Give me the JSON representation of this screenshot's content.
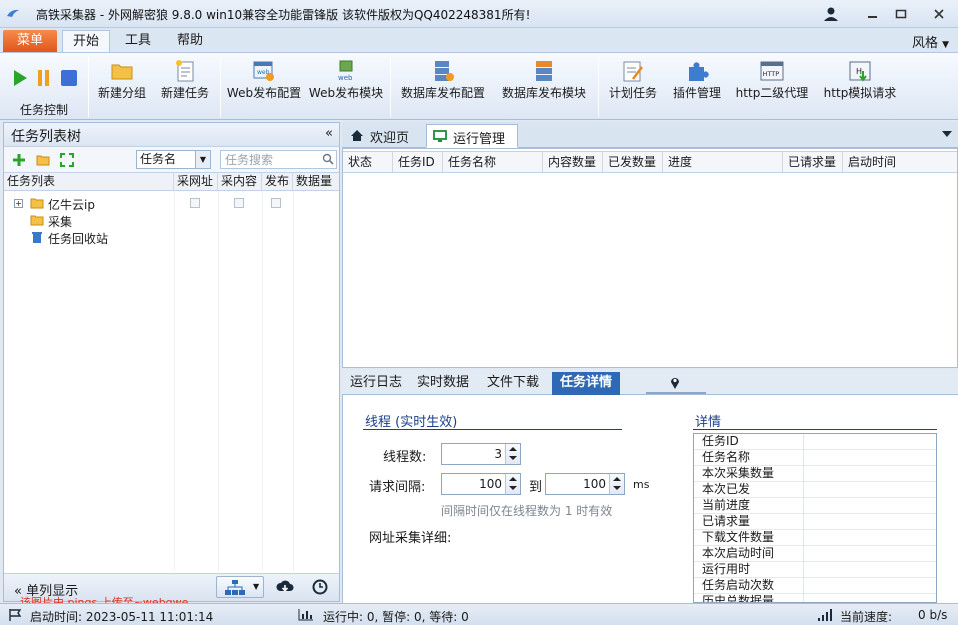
{
  "window": {
    "title": "高铁采集器 - 外网解密狼 9.8.0 win10兼容全功能雷锋版  该软件版权为QQ402248381所有!"
  },
  "ribbon_tabs": {
    "menu": "菜单",
    "start": "开始",
    "tools": "工具",
    "help": "帮助",
    "style": "风格"
  },
  "ribbon": {
    "task_control": "任务控制",
    "buttons": [
      {
        "label": "新建分组",
        "icon": "folder-icon"
      },
      {
        "label": "新建任务",
        "icon": "new-task-icon"
      },
      {
        "label": "Web发布配置",
        "icon": "web-config-icon"
      },
      {
        "label": "Web发布模块",
        "icon": "web-module-icon"
      },
      {
        "label": "数据库发布配置",
        "icon": "db-config-icon"
      },
      {
        "label": "数据库发布模块",
        "icon": "db-module-icon"
      },
      {
        "label": "计划任务",
        "icon": "schedule-icon"
      },
      {
        "label": "插件管理",
        "icon": "plugin-icon"
      },
      {
        "label": "http二级代理",
        "icon": "http-proxy-icon"
      },
      {
        "label": "http模拟请求",
        "icon": "http-request-icon"
      }
    ],
    "icon_text": {
      "web": "web",
      "http": "HTTP",
      "h": "H"
    }
  },
  "left_panel": {
    "title": "任务列表树",
    "collapse_glyph": "«",
    "field_select": "任务名",
    "search_placeholder": "任务搜索",
    "columns": [
      "任务列表",
      "采网址",
      "采内容",
      "发布",
      "数据量"
    ],
    "tree": [
      {
        "label": "亿牛云ip",
        "expander": "+"
      },
      {
        "label": "采集"
      },
      {
        "label": "任务回收站"
      }
    ],
    "single_column": "单列显示",
    "single_column_glyph": "«"
  },
  "watermark": "该图片由 pings 上传至~webqwe",
  "doc_tabs": {
    "welcome": "欢迎页",
    "run_manage": "运行管理"
  },
  "grid": {
    "columns": [
      "状态",
      "任务ID",
      "任务名称",
      "内容数量",
      "已发数量",
      "进度",
      "已请求量",
      "启动时间"
    ]
  },
  "bottom_tabs": [
    "运行日志",
    "实时数据",
    "文件下载",
    "任务详情"
  ],
  "detail_pane": {
    "thread_title": "线程 (实时生效)",
    "thread_count_label": "线程数:",
    "thread_count": "3",
    "interval_label": "请求间隔:",
    "interval_from": "100",
    "to_label": "到",
    "interval_to": "100",
    "unit": "ms",
    "interval_hint": "间隔时间仅在线程数为 1 时有效",
    "url_detail_label": "网址采集详细:",
    "details_title": "详情",
    "details_rows": [
      "任务ID",
      "任务名称",
      "本次采集数量",
      "本次已发",
      "当前进度",
      "已请求量",
      "下载文件数量",
      "本次启动时间",
      "运行用时",
      "任务启动次数",
      "历史总数据量"
    ]
  },
  "status_bar": {
    "start_time": "启动时间: 2023-05-11 11:01:14",
    "running": "运行中: 0, 暂停: 0, 等待: 0",
    "speed_label": "当前速度:",
    "speed_value": "0 b/s"
  },
  "colors": {
    "accent": "#2d69b4",
    "menu_tab": "#e1561a",
    "section_title": "#1d3e8a",
    "watermark": "#e0301e"
  }
}
